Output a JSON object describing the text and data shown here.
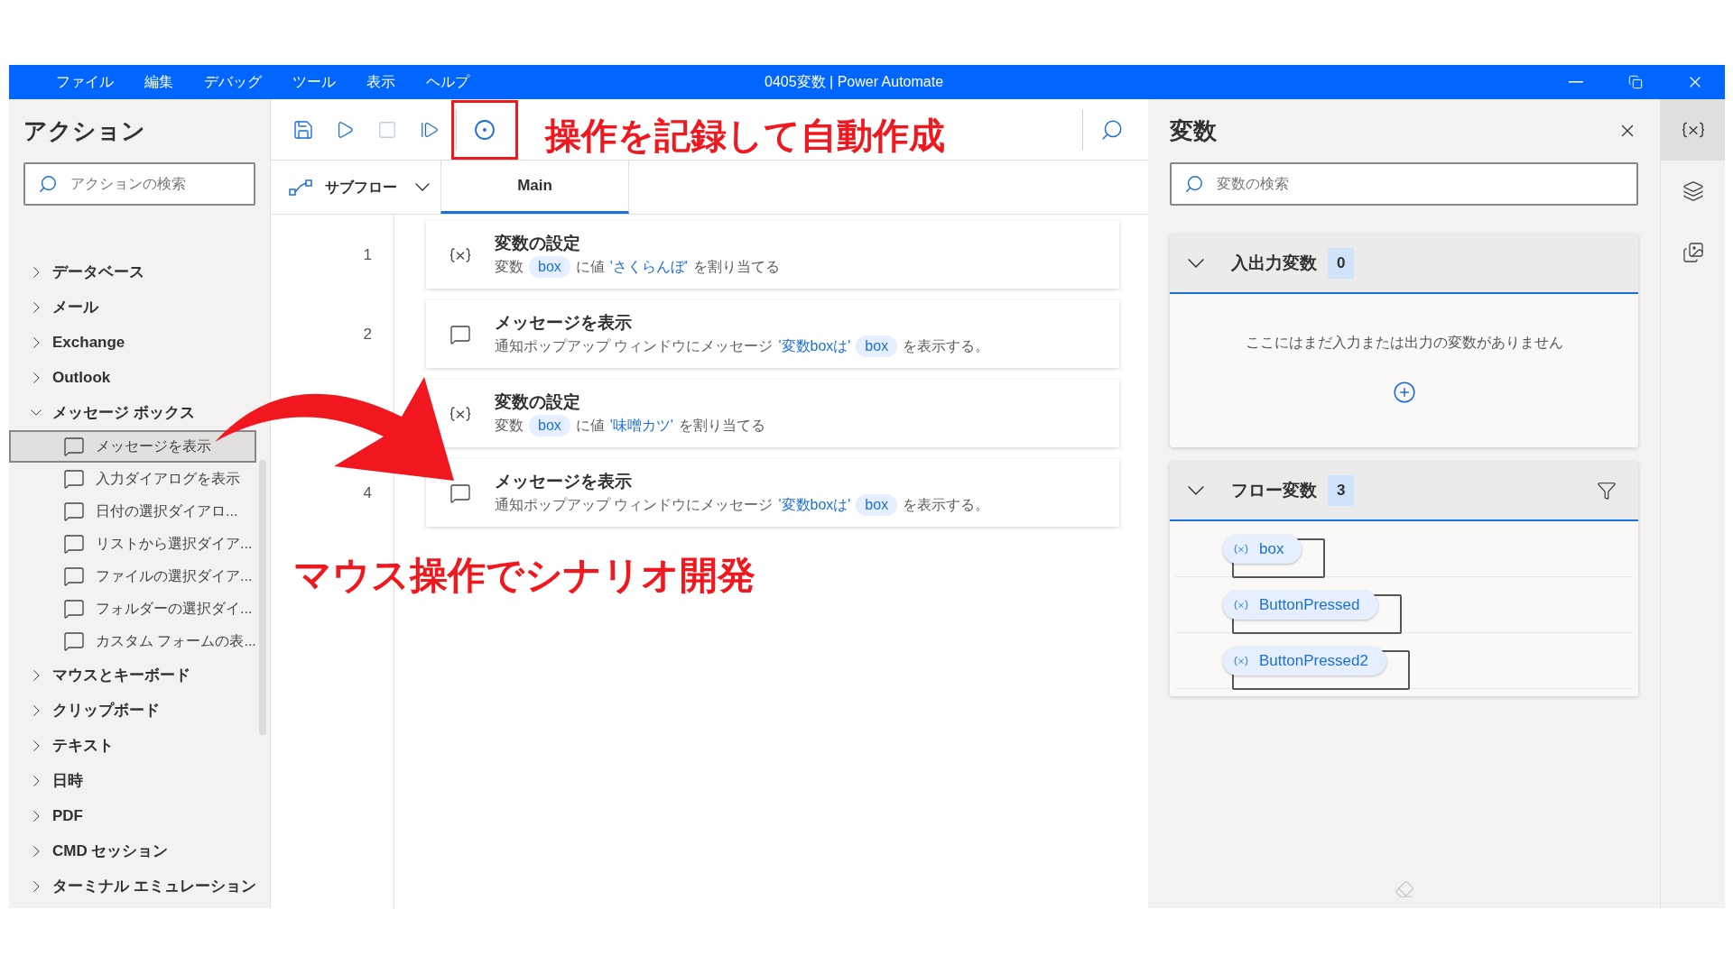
{
  "window": {
    "title": "0405変数 | Power Automate"
  },
  "menu": [
    "ファイル",
    "編集",
    "デバッグ",
    "ツール",
    "表示",
    "ヘルプ"
  ],
  "actions_panel": {
    "title": "アクション",
    "search": {
      "placeholder": "アクションの検索"
    },
    "tree": [
      {
        "label": "データベース",
        "expanded": false
      },
      {
        "label": "メール",
        "expanded": false
      },
      {
        "label": "Exchange",
        "expanded": false
      },
      {
        "label": "Outlook",
        "expanded": false
      },
      {
        "label": "メッセージ ボックス",
        "expanded": true,
        "children": [
          {
            "label": "メッセージを表示",
            "selected": true
          },
          {
            "label": "入力ダイアログを表示",
            "selected": false
          },
          {
            "label": "日付の選択ダイアロ...",
            "selected": false
          },
          {
            "label": "リストから選択ダイア...",
            "selected": false
          },
          {
            "label": "ファイルの選択ダイア...",
            "selected": false
          },
          {
            "label": "フォルダーの選択ダイ...",
            "selected": false
          },
          {
            "label": "カスタム フォームの表...",
            "selected": false
          }
        ]
      },
      {
        "label": "マウスとキーボード",
        "expanded": false
      },
      {
        "label": "クリップボード",
        "expanded": false
      },
      {
        "label": "テキスト",
        "expanded": false
      },
      {
        "label": "日時",
        "expanded": false
      },
      {
        "label": "PDF",
        "expanded": false
      },
      {
        "label": "CMD セッション",
        "expanded": false
      },
      {
        "label": "ターミナル エミュレーション",
        "expanded": false
      }
    ]
  },
  "subflow": {
    "label": "サブフロー"
  },
  "tabs": [
    {
      "label": "Main",
      "selected": true
    }
  ],
  "steps": [
    {
      "number": "1",
      "kind": "set_variable",
      "title": "変数の設定",
      "description": [
        {
          "kind": "text",
          "text": "変数"
        },
        {
          "kind": "variable",
          "text": "box"
        },
        {
          "kind": "text",
          "text": "に値"
        },
        {
          "kind": "literal",
          "text": "'さくらんぼ'"
        },
        {
          "kind": "text",
          "text": "を割り当てる"
        }
      ]
    },
    {
      "number": "2",
      "kind": "message",
      "title": "メッセージを表示",
      "description": [
        {
          "kind": "text",
          "text": "通知ポップアップ ウィンドウにメッセージ"
        },
        {
          "kind": "literal",
          "text": "'変数boxは'"
        },
        {
          "kind": "variable",
          "text": "box"
        },
        {
          "kind": "text",
          "text": "を表示する。"
        }
      ]
    },
    {
      "kind": "set_variable",
      "title": "変数の設定",
      "description": [
        {
          "kind": "text",
          "text": "変数"
        },
        {
          "kind": "variable",
          "text": "box"
        },
        {
          "kind": "text",
          "text": "に値"
        },
        {
          "kind": "literal",
          "text": "'味噌カツ'"
        },
        {
          "kind": "text",
          "text": "を割り当てる"
        }
      ]
    },
    {
      "number": "4",
      "kind": "message",
      "title": "メッセージを表示",
      "description": [
        {
          "kind": "text",
          "text": "通知ポップアップ ウィンドウにメッセージ"
        },
        {
          "kind": "literal",
          "text": "'変数boxは'"
        },
        {
          "kind": "variable",
          "text": "box"
        },
        {
          "kind": "text",
          "text": "を表示する。"
        }
      ]
    }
  ],
  "variables_panel": {
    "title": "変数",
    "search": {
      "placeholder": "変数の検索"
    },
    "sections": [
      {
        "title": "入出力変数",
        "count": "0",
        "expanded": true,
        "empty_message": "ここにはまだ入力または出力の変数がありません"
      },
      {
        "title": "フロー変数",
        "count": "3",
        "expanded": true,
        "filter": true,
        "variables": [
          "box",
          "ButtonPressed",
          "ButtonPressed2"
        ]
      }
    ]
  },
  "annotations": [
    {
      "text": "操作を記録して自動作成"
    },
    {
      "text": "マウス操作でシナリオ開発"
    }
  ]
}
